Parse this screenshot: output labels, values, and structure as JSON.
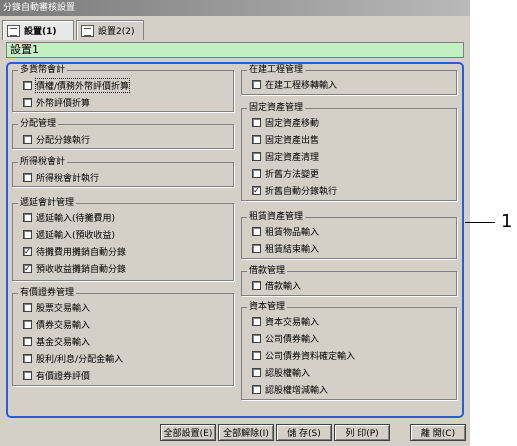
{
  "window": {
    "title": "分錄自動審核設置"
  },
  "tabs": [
    {
      "label": "設置(1)"
    },
    {
      "label": "設置2(2)"
    }
  ],
  "setting_name": "設置1",
  "groups": [
    {
      "title": "多貨幣會計",
      "items": [
        {
          "label": "債權/債務外幣評價折算",
          "checked": false,
          "highlight": true
        },
        {
          "label": "外幣評價折算",
          "checked": false
        }
      ]
    },
    {
      "title": "分配管理",
      "items": [
        {
          "label": "分配分錄執行",
          "checked": false
        }
      ]
    },
    {
      "title": "所得稅會計",
      "items": [
        {
          "label": "所得稅會計執行",
          "checked": false
        }
      ]
    },
    {
      "title": "遞延會計管理",
      "items": [
        {
          "label": "遞延輸入(待攤費用)",
          "checked": false
        },
        {
          "label": "遞延輸入(預收收益)",
          "checked": false
        },
        {
          "label": "待攤費用攤銷自動分錄",
          "checked": true
        },
        {
          "label": "預收收益攤銷自動分錄",
          "checked": true
        }
      ]
    },
    {
      "title": "有價證券管理",
      "items": [
        {
          "label": "股票交易輸入",
          "checked": false
        },
        {
          "label": "債券交易輸入",
          "checked": false
        },
        {
          "label": "基金交易輸入",
          "checked": false
        },
        {
          "label": "股利/利息/分配金輸入",
          "checked": false
        },
        {
          "label": "有價證券評價",
          "checked": false
        }
      ]
    },
    {
      "title": "在建工程管理",
      "items": [
        {
          "label": "在建工程移轉輸入",
          "checked": false
        }
      ]
    },
    {
      "title": "固定資產管理",
      "items": [
        {
          "label": "固定資產移動",
          "checked": false
        },
        {
          "label": "固定資產出售",
          "checked": false
        },
        {
          "label": "固定資產清理",
          "checked": false
        },
        {
          "label": "折舊方法變更",
          "checked": false
        },
        {
          "label": "折舊自動分錄執行",
          "checked": true
        }
      ]
    },
    {
      "title": "租賃資產管理",
      "items": [
        {
          "label": "租賃物品輸入",
          "checked": false
        },
        {
          "label": "租賃結束輸入",
          "checked": false
        }
      ]
    },
    {
      "title": "借款管理",
      "items": [
        {
          "label": "借款輸入",
          "checked": false
        }
      ]
    },
    {
      "title": "資本管理",
      "items": [
        {
          "label": "資本交易輸入",
          "checked": false
        },
        {
          "label": "公司債券輸入",
          "checked": false
        },
        {
          "label": "公司債券資料確定輸入",
          "checked": false
        },
        {
          "label": "認股權輸入",
          "checked": false
        },
        {
          "label": "認股權增減輸入",
          "checked": false
        }
      ]
    }
  ],
  "buttons": {
    "select_all": "全部設置(E)",
    "clear_all": "全部解除(I)",
    "save": "儲 存(S)",
    "print": "列 印(P)",
    "close": "離 開(C)"
  },
  "callout": "1"
}
